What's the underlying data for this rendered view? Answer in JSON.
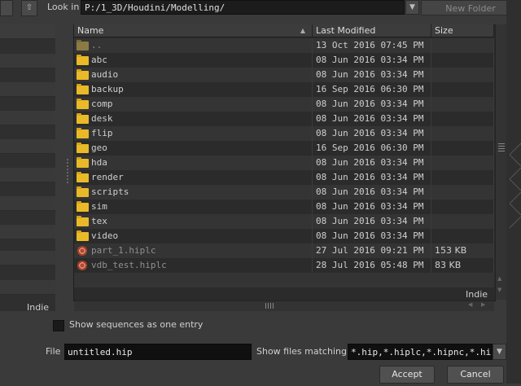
{
  "toolbar": {
    "lookin_label": "Look in",
    "path": "P:/1_3D/Houdini/Modelling/",
    "new_folder_label": "New Folder"
  },
  "columns": {
    "name": "Name",
    "modified": "Last Modified",
    "size": "Size"
  },
  "files": [
    {
      "name": "..",
      "modified": "13 Oct 2016 07:45 PM",
      "size": "",
      "type": "folder-up"
    },
    {
      "name": "abc",
      "modified": "08 Jun 2016 03:34 PM",
      "size": "",
      "type": "folder"
    },
    {
      "name": "audio",
      "modified": "08 Jun 2016 03:34 PM",
      "size": "",
      "type": "folder"
    },
    {
      "name": "backup",
      "modified": "16 Sep 2016 06:30 PM",
      "size": "",
      "type": "folder"
    },
    {
      "name": "comp",
      "modified": "08 Jun 2016 03:34 PM",
      "size": "",
      "type": "folder"
    },
    {
      "name": "desk",
      "modified": "08 Jun 2016 03:34 PM",
      "size": "",
      "type": "folder"
    },
    {
      "name": "flip",
      "modified": "08 Jun 2016 03:34 PM",
      "size": "",
      "type": "folder"
    },
    {
      "name": "geo",
      "modified": "16 Sep 2016 06:30 PM",
      "size": "",
      "type": "folder"
    },
    {
      "name": "hda",
      "modified": "08 Jun 2016 03:34 PM",
      "size": "",
      "type": "folder"
    },
    {
      "name": "render",
      "modified": "08 Jun 2016 03:34 PM",
      "size": "",
      "type": "folder"
    },
    {
      "name": "scripts",
      "modified": "08 Jun 2016 03:34 PM",
      "size": "",
      "type": "folder"
    },
    {
      "name": "sim",
      "modified": "08 Jun 2016 03:34 PM",
      "size": "",
      "type": "folder"
    },
    {
      "name": "tex",
      "modified": "08 Jun 2016 03:34 PM",
      "size": "",
      "type": "folder"
    },
    {
      "name": "video",
      "modified": "08 Jun 2016 03:34 PM",
      "size": "",
      "type": "folder"
    },
    {
      "name": "part_1.hiplc",
      "modified": "27 Jul 2016 09:21 PM",
      "size": "153 KB",
      "type": "hip"
    },
    {
      "name": "vdb_test.hiplc",
      "modified": "28 Jul 2016 05:48 PM",
      "size": "83 KB",
      "type": "hip"
    }
  ],
  "list_watermark": "Indie",
  "left_watermark": "Indie",
  "show_sequences_label": "Show sequences as one entry",
  "file_label": "File",
  "file_value": "untitled.hip",
  "match_label": "Show files matching",
  "match_value": "*.hip,*.hiplc,*.hipnc,*.hip",
  "accept_label": "Accept",
  "cancel_label": "Cancel",
  "icons": {
    "up": "up-arrow-icon",
    "dropdown": "chevron-down-icon",
    "folder": "folder-icon",
    "hip": "houdini-file-icon"
  }
}
